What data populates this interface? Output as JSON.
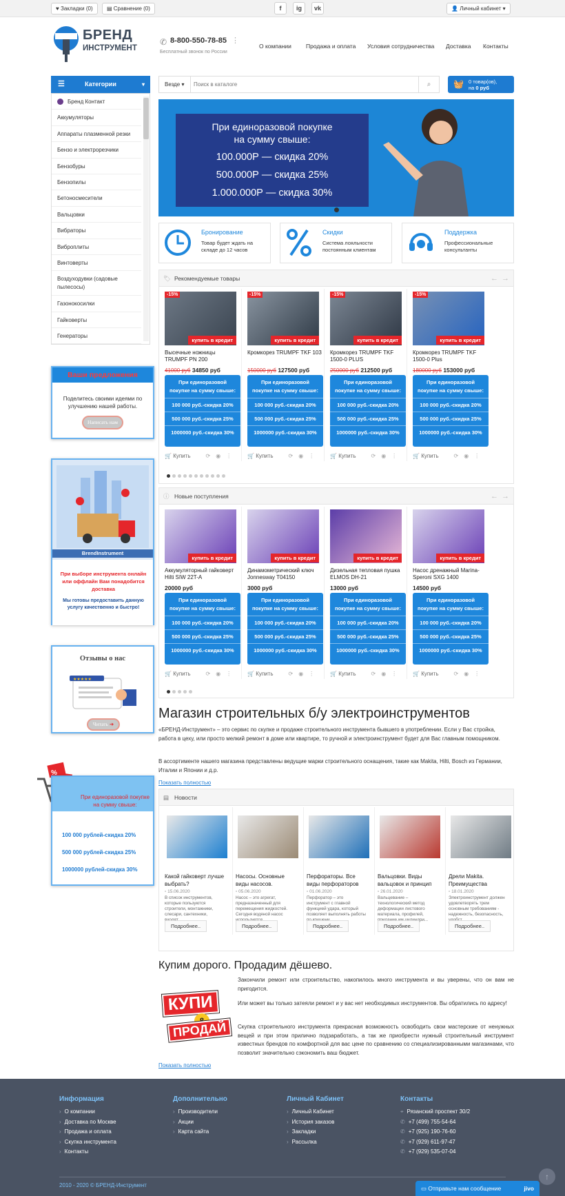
{
  "topbar": {
    "bookmarks": "Закладки (0)",
    "compare": "Сравнение (0)",
    "account": "Личный кабинет",
    "social": [
      "f",
      "ig",
      "vk"
    ]
  },
  "header": {
    "logo_line1": "БРЕНД",
    "logo_line2": "ИНСТРУМЕНТ",
    "phone": "8-800-550-78-85",
    "phone_note": "Бесплатный звонок по России",
    "nav": [
      "О компании",
      "Продажа и оплата",
      "Условия сотрудничества",
      "Доставка",
      "Контакты"
    ]
  },
  "categories": {
    "title": "Категории",
    "items": [
      "Бренд Контакт",
      "Аккумуляторы",
      "Аппараты плазменной резки",
      "Бензо и электрорезчики",
      "Бензобуры",
      "Бензопилы",
      "Бетоносмесители",
      "Вальцовки",
      "Вибраторы",
      "Виброплиты",
      "Винтоверты",
      "Воздуходувки (садовые пылесосы)",
      "Газонокосилки",
      "Гайковерты",
      "Генераторы"
    ]
  },
  "search": {
    "scope": "Везде",
    "placeholder": "Поиск в каталоге"
  },
  "cart": {
    "line1": "0 товар(ов),",
    "line2_prefix": "на ",
    "line2_value": "0 руб"
  },
  "hero": {
    "lines": [
      "При единоразовой покупке",
      "на сумму свыше:",
      "100.000Р — скидка 20%",
      "500.000Р — скидка 25%",
      "1.000.000Р — скидка 30%"
    ]
  },
  "features": [
    {
      "title": "Бронирование",
      "text": "Товар будет ждать на складе до 12 часов",
      "icon": "clock-icon"
    },
    {
      "title": "Скидки",
      "text": "Система лояльности постоянным клиентам",
      "icon": "percent-icon"
    },
    {
      "title": "Поддержка",
      "text": "Профессиональные консультанты",
      "icon": "headset-icon"
    }
  ],
  "sidebar_widgets": {
    "suggest": {
      "title": "Ваши предложения",
      "text": "Поделитесь своими идеями по улучшению нашей работы.",
      "button": "Написать нам"
    },
    "delivery": {
      "brand": "BrendInstrument",
      "red": "При выборе инструмента онлайн или оффлайн Вам понадобится доставка",
      "blue": "Мы готовы предоставить данную услугу качественно и быстро!"
    },
    "reviews": {
      "title": "Отзывы о нас",
      "button": "Читать"
    },
    "discount": {
      "head": "При единоразовой покупке на сумму свыше:",
      "rows": [
        "100 000 рублей-скидка 20%",
        "500 000 рублей-скидка 25%",
        "1000000 рублей-скидка 30%"
      ]
    }
  },
  "promo_rows": [
    "При единоразовой покупке на сумму свыше:",
    "100 000 руб.-скидка 20%",
    "500 000 руб.-скидка 25%",
    "1000000 руб.-скидка 30%"
  ],
  "recommended": {
    "title": "Рекомендуемые товары",
    "credit": "купить в кредит",
    "buy": "Купить",
    "items": [
      {
        "badge": "-15%",
        "name": "Высечные ножницы TRUMPF PN 200",
        "old": "41000 руб",
        "price": "34850 руб"
      },
      {
        "badge": "-15%",
        "name": "Кромкорез TRUMPF TKF 103",
        "old": "150000 руб",
        "price": "127500 руб"
      },
      {
        "badge": "-15%",
        "name": "Кромкорез TRUMPF TKF 1500-0 PLUS",
        "old": "250000 руб",
        "price": "212500 руб"
      },
      {
        "badge": "-15%",
        "name": "Кромкорез TRUMPF TKF 1500-0 Plus",
        "old": "180000 руб",
        "price": "153000 руб"
      }
    ]
  },
  "new_items": {
    "title": "Новые поступления",
    "credit": "купить в кредит",
    "buy": "Купить",
    "items": [
      {
        "name": "Аккумуляторный гайковерт Hilti SIW 22T-A",
        "price": "20000 руб"
      },
      {
        "name": "Динамометрический ключ Jonnesway T04150",
        "price": "3000 руб"
      },
      {
        "name": "Дизельная тепловая пушка ELMOS DH-21",
        "price": "13000 руб"
      },
      {
        "name": "Насос дренажный Marina-Speroni SXG 1400",
        "price": "14500 руб"
      }
    ]
  },
  "about": {
    "title": "Магазин строительных б/у электроинструментов",
    "p1": "«БРЕНД-Инструмент» – это сервис по скупке и продаже строительного инструмента бывшего в употреблении. Если у Вас стройка, работа в цеху, или просто мелкий ремонт в доме или квартире, то ручной и электроинструмент будет для Вас главным помощником.",
    "p2": "В ассортименте нашего магазина представлены ведущие марки строительного оснащения, такие как Makita, Hilti, Bosch из Германии, Италии и Японии и д.р.",
    "more": "Показать полностью"
  },
  "news": {
    "title": "Новости",
    "more": "Подробнее..",
    "items": [
      {
        "title": "Какой гайковерт лучше выбрать?",
        "date": "15.06.2020",
        "text": "В список инструментов, которые пользуются строители, монтажники, слесари, сантехники, входят..."
      },
      {
        "title": "Насосы. Основные виды насосов.",
        "date": "05.06.2020",
        "text": "Насос – это агрегат, предназначенный для перемещения жидкостей. Сегодня водяной насос используется..."
      },
      {
        "title": "Перфораторы. Все виды перфораторов",
        "date": "01.06.2020",
        "text": "Перфоратор – это инструмент с главной функцией удара, который позволяет выполнять работы по крушени..."
      },
      {
        "title": "Вальцовки. Виды вальцовок и принцип",
        "date": "26.01.2020",
        "text": "Вальцевание – технологический метод деформации листового материала, профилей, придание им цилиндри..."
      },
      {
        "title": "Дрели Makita. Преимущества",
        "date": "18.01.2020",
        "text": "Электроинструмент должен удовлетворять трем основным требованиям - надежность, безопасность, удобст..."
      }
    ]
  },
  "buysell": {
    "title": "Купим дорого. Продадим дёшево.",
    "logo_top": "КУПИ",
    "logo_amp": "&",
    "logo_bottom": "ПРОДАЙ",
    "p1": "Закончили ремонт или строительство, накопилось много инструмента и вы уверены, что он вам не пригодится.",
    "p2": "Или может вы только затеяли ремонт и у вас нет необходимых инструментов. Вы обратились по адресу!",
    "p3": "Скупка строительного инструмента прекрасная возможность освободить свои мастерские от ненужных вещей и при этом прилично подзаработать, а так же приобрести нужный строительный инструмент известных брендов по комфортной для вас цене по сравнению со специализированными магазинами, что позволит значительно сэкономить ваш бюджет.",
    "more": "Показать полностью"
  },
  "footer": {
    "cols": [
      {
        "title": "Информация",
        "links": [
          "О компании",
          "Доставка по Москве",
          "Продажа и оплата",
          "Скупка инструмента",
          "Контакты"
        ]
      },
      {
        "title": "Дополнительно",
        "links": [
          "Производители",
          "Акции",
          "Карта сайта"
        ]
      },
      {
        "title": "Личный Кабинет",
        "links": [
          "Личный Кабинет",
          "История заказов",
          "Закладки",
          "Рассылка"
        ]
      },
      {
        "title": "Контакты",
        "links": [
          "Рязанский проспект 30/2",
          "+7 (499) 755-54-64",
          "+7 (925) 190-76-60",
          "+7 (929) 611-97-47",
          "+7 (929) 535-07-04"
        ]
      }
    ],
    "copyright": "2010 - 2020 © БРЕНД-Инструмент",
    "chat": "Отправьте нам сообщение",
    "chat_brand": "jivo"
  },
  "colors": {
    "accent": "#1e7bd1",
    "red": "#e5262b",
    "footer": "#4a5363"
  }
}
